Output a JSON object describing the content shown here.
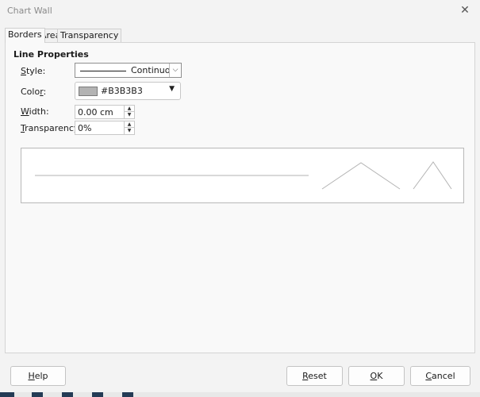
{
  "window": {
    "title": "Chart Wall",
    "close_glyph": "✕"
  },
  "tabs": [
    {
      "label": "Borders",
      "active": true
    },
    {
      "label": "Area",
      "active": false
    },
    {
      "label": "Transparency",
      "active": false
    }
  ],
  "line_properties": {
    "heading": "Line Properties",
    "style": {
      "label_mnemonic": "S",
      "label_rest": "tyle:",
      "value": "Continuous",
      "dropdown_glyph": "⌵"
    },
    "color": {
      "label_first": "Colo",
      "label_mnemonic": "r",
      "label_rest": ":",
      "value": "#B3B3B3",
      "swatch": "#B3B3B3",
      "caret": "▼"
    },
    "width": {
      "label_mnemonic": "W",
      "label_rest": "idth:",
      "value": "0.00 cm"
    },
    "transparency": {
      "label_mnemonic": "T",
      "label_rest": "ransparency:",
      "value": "0%"
    }
  },
  "spin_glyphs": {
    "up": "▲",
    "down": "▼"
  },
  "buttons": {
    "help": {
      "label_mnemonic": "H",
      "label_rest": "elp"
    },
    "reset": {
      "label_mnemonic": "R",
      "label_rest": "eset"
    },
    "ok": {
      "label_mnemonic": "O",
      "label_rest": "K"
    },
    "cancel": {
      "label_mnemonic": "C",
      "label_rest": "ancel"
    }
  },
  "colors": {
    "accent": "#243b55",
    "preview_line": "#B3B3B3"
  }
}
